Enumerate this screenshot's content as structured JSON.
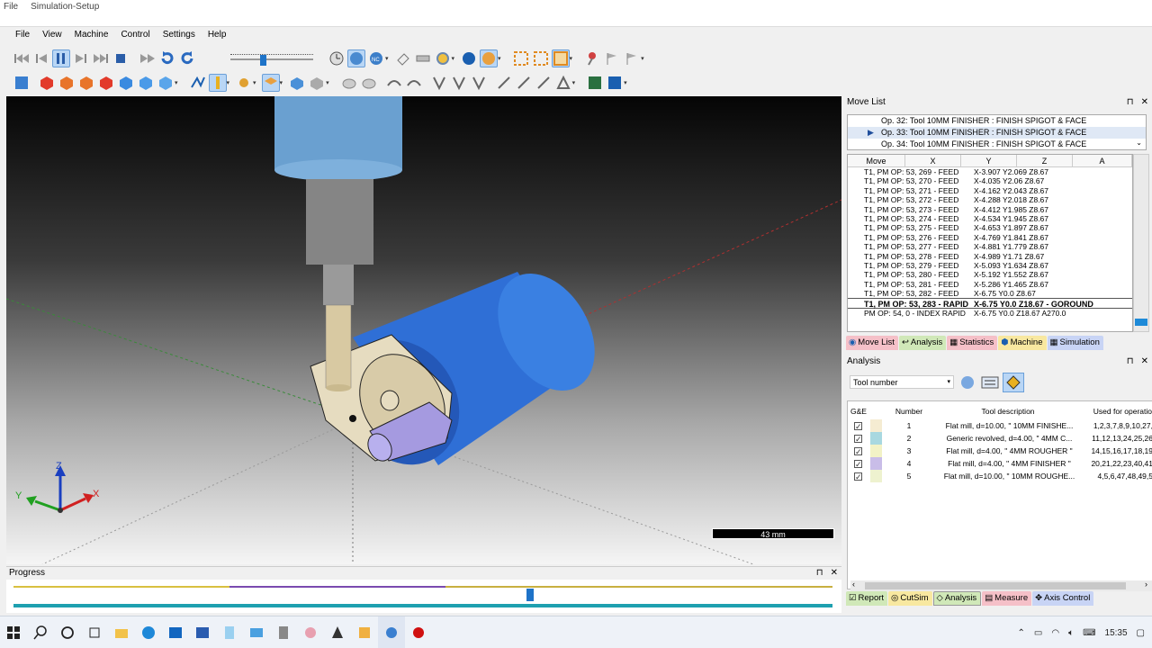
{
  "window": {
    "menu_file": "File",
    "title": "Simulation-Setup"
  },
  "menu": [
    "File",
    "View",
    "Machine",
    "Control",
    "Settings",
    "Help"
  ],
  "viewport": {
    "scale_label": "43 mm",
    "axis_x": "X",
    "axis_y": "Y",
    "axis_z": "Z"
  },
  "progress": {
    "title": "Progress",
    "position": 0.62
  },
  "movelist": {
    "title": "Move List",
    "ops": [
      {
        "label": "Op. 32: Tool  10MM FINISHER : FINISH SPIGOT & FACE"
      },
      {
        "label": "Op. 33: Tool  10MM FINISHER : FINISH SPIGOT & FACE"
      },
      {
        "label": "Op. 34: Tool  10MM FINISHER : FINISH SPIGOT & FACE"
      }
    ],
    "columns": [
      "Move",
      "X",
      "Y",
      "Z",
      "A"
    ],
    "rows": [
      {
        "move": "T1, PM OP: 53, 269 -  FEED",
        "coords": "X-3.907 Y2.069 Z8.67"
      },
      {
        "move": "T1, PM OP: 53, 270 -  FEED",
        "coords": "X-4.035 Y2.06 Z8.67"
      },
      {
        "move": "T1, PM OP: 53, 271 -  FEED",
        "coords": "X-4.162 Y2.043 Z8.67"
      },
      {
        "move": "T1, PM OP: 53, 272 -  FEED",
        "coords": "X-4.288 Y2.018 Z8.67"
      },
      {
        "move": "T1, PM OP: 53, 273 -  FEED",
        "coords": "X-4.412 Y1.985 Z8.67"
      },
      {
        "move": "T1, PM OP: 53, 274 -  FEED",
        "coords": "X-4.534 Y1.945 Z8.67"
      },
      {
        "move": "T1, PM OP: 53, 275 -  FEED",
        "coords": "X-4.653 Y1.897 Z8.67"
      },
      {
        "move": "T1, PM OP: 53, 276 -  FEED",
        "coords": "X-4.769 Y1.841 Z8.67"
      },
      {
        "move": "T1, PM OP: 53, 277 -  FEED",
        "coords": "X-4.881 Y1.779 Z8.67"
      },
      {
        "move": "T1, PM OP: 53, 278 -  FEED",
        "coords": "X-4.989 Y1.71 Z8.67"
      },
      {
        "move": "T1, PM OP: 53, 279 -  FEED",
        "coords": "X-5.093 Y1.634 Z8.67"
      },
      {
        "move": "T1, PM OP: 53, 280 -  FEED",
        "coords": "X-5.192 Y1.552 Z8.67"
      },
      {
        "move": "T1, PM OP: 53, 281 -  FEED",
        "coords": "X-5.286 Y1.465 Z8.67"
      },
      {
        "move": "T1, PM OP: 53, 282 -  FEED",
        "coords": "X-6.75 Y0.0 Z8.67"
      }
    ],
    "current_row": {
      "move": "T1, PM OP: 53, 283 - RAPID",
      "coords": "X-6.75 Y0.0 Z18.67 - GOROUND"
    },
    "index_row": {
      "move": "PM OP: 54, 0 -  INDEX RAPID",
      "coords": "X-6.75 Y0.0 Z18.67 A270.0"
    }
  },
  "tabs_top": [
    "Move List",
    "Analysis",
    "Statistics",
    "Machine",
    "Simulation"
  ],
  "analysis": {
    "title": "Analysis",
    "filter": "Tool number",
    "columns": [
      "G&E",
      "Number",
      "Tool description",
      "Used for operatio"
    ],
    "tools": [
      {
        "num": "1",
        "desc": "Flat mill, d=10.00, \" 10MM FINISHE...",
        "ops": "1,2,3,7,8,9,10,27,",
        "color": "#f5ecd2"
      },
      {
        "num": "2",
        "desc": "Generic revolved, d=4.00, \" 4MM C...",
        "ops": "11,12,13,24,25,26",
        "color": "#a8d8e0"
      },
      {
        "num": "3",
        "desc": "Flat mill, d=4.00, \" 4MM ROUGHER \"",
        "ops": "14,15,16,17,18,19",
        "color": "#f2f2c6"
      },
      {
        "num": "4",
        "desc": "Flat mill, d=4.00, \" 4MM FINISHER \"",
        "ops": "20,21,22,23,40,41",
        "color": "#c9bde8"
      },
      {
        "num": "5",
        "desc": "Flat mill, d=10.00, \" 10MM ROUGHE...",
        "ops": "4,5,6,47,48,49,5",
        "color": "#eef2cf"
      }
    ]
  },
  "tabs_bottom": [
    "Report",
    "CutSim",
    "Analysis",
    "Measure",
    "Axis Control"
  ],
  "taskbar": {
    "time": "15:35"
  }
}
